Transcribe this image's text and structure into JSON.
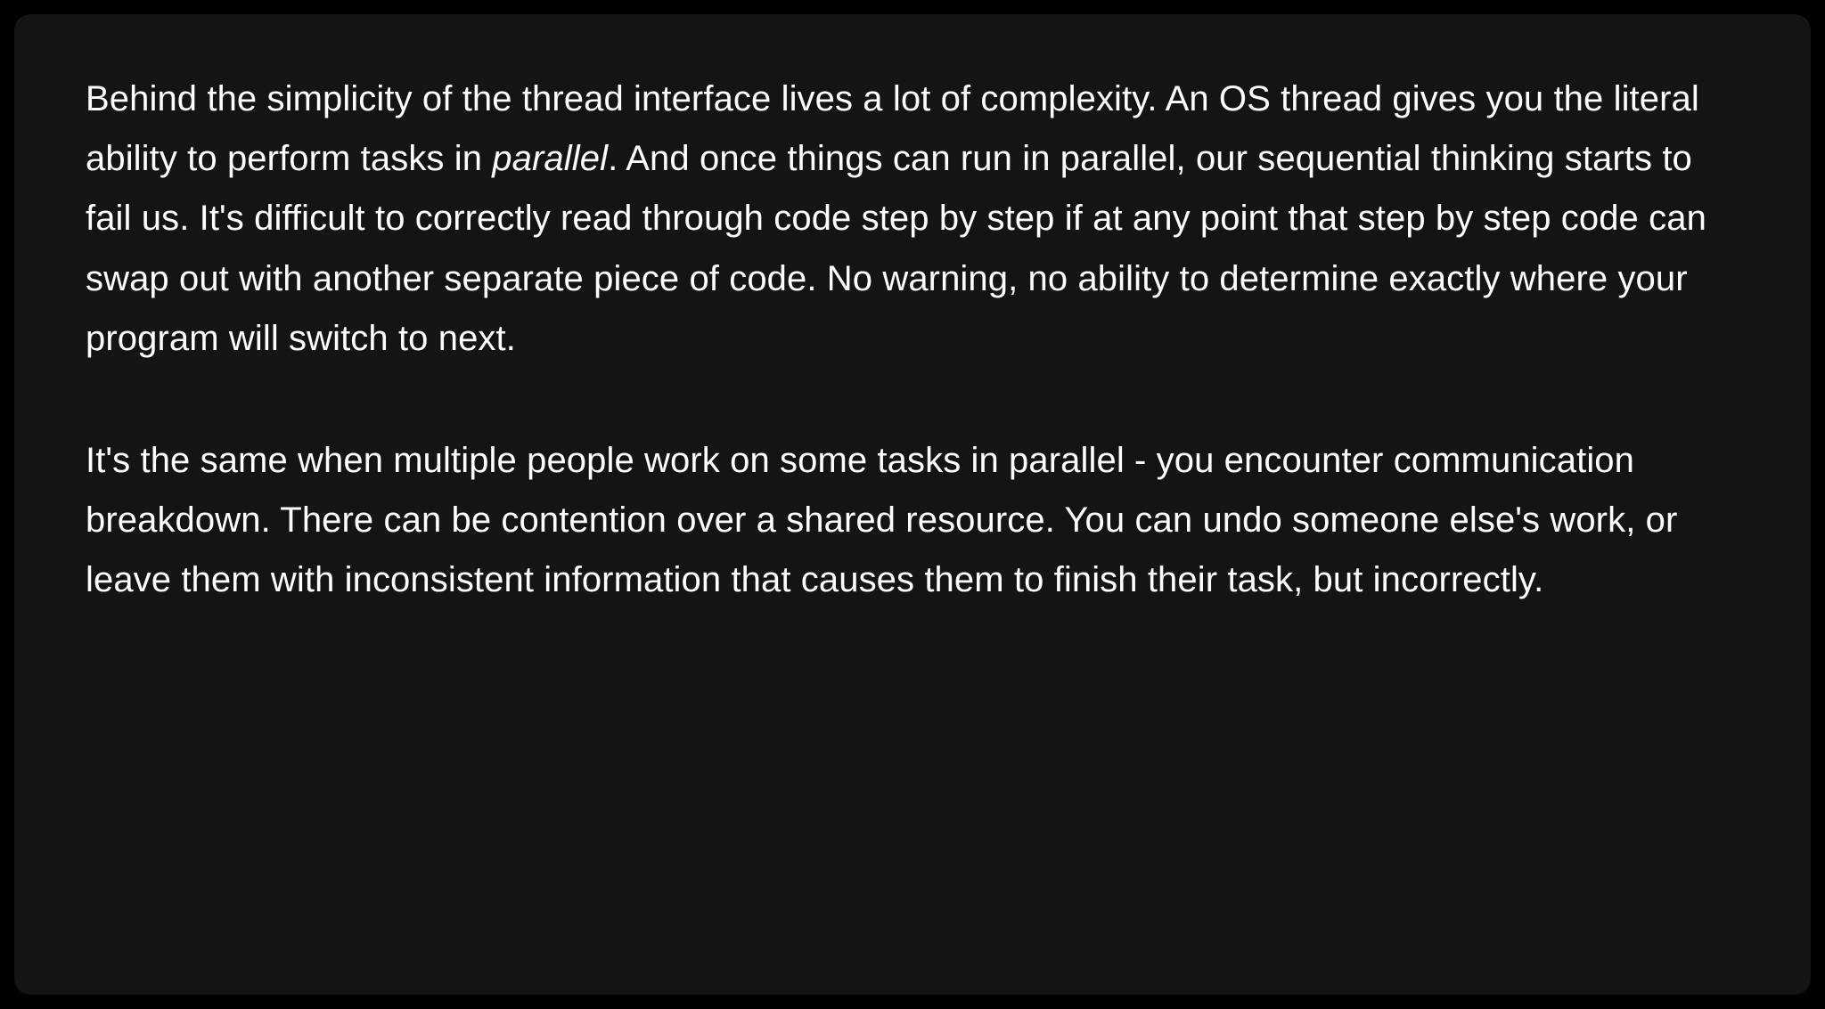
{
  "paragraphs": [
    {
      "pre": "Behind the simplicity of the thread interface lives a lot of complexity. An OS thread gives you the literal ability to perform tasks in ",
      "em": "parallel",
      "post": ". And once things can run in parallel, our sequential thinking starts to fail us. It's difficult to correctly read through code step by step if at any point that step by step code can swap out with another separate piece of code. No warning, no ability to determine exactly where your program will switch to next."
    },
    {
      "pre": "It's the same when multiple people work on some tasks in parallel - you encounter communication breakdown. There can be contention over a shared resource. You can undo someone else's work, or leave them with inconsistent information that causes them to finish their task, but incorrectly.",
      "em": "",
      "post": ""
    }
  ]
}
